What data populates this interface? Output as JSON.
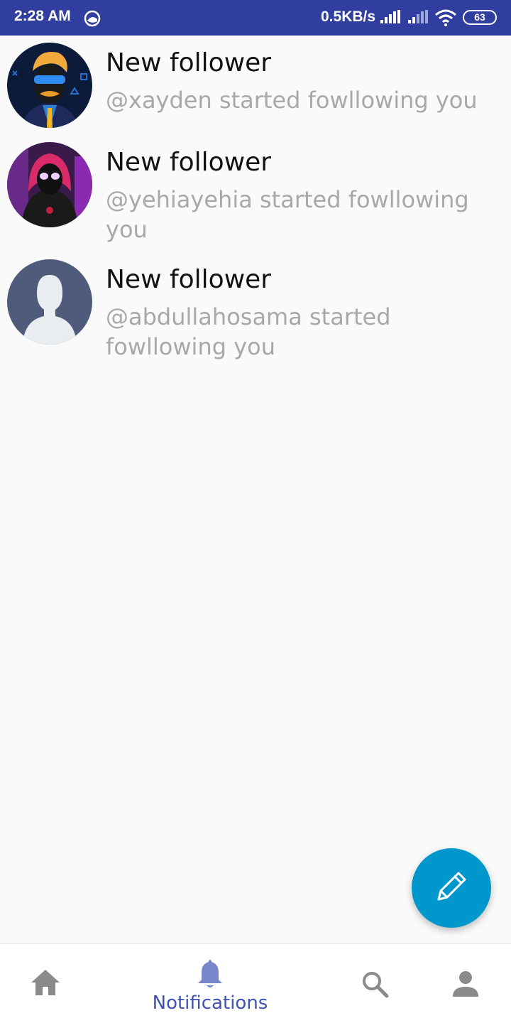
{
  "status_bar": {
    "time": "2:28 AM",
    "net_speed": "0.5KB/s",
    "battery": "63",
    "background": "#303f9f"
  },
  "notifications": [
    {
      "title": "New follower",
      "body": "@xayden started fowllowing you",
      "avatar_icon": "cartoon-man-avatar"
    },
    {
      "title": "New follower",
      "body": "@yehiayehia started fowllowing you",
      "avatar_icon": "hooded-figure-avatar"
    },
    {
      "title": "New follower",
      "body": "@abdullahosama started fowllowing you",
      "avatar_icon": "default-person-avatar"
    }
  ],
  "fab": {
    "icon": "pencil-icon",
    "color": "#0097cc"
  },
  "bottom_nav": {
    "active_label": "Notifications",
    "active_color": "#3f51b5",
    "items": [
      "home-icon",
      "bell-icon",
      "search-icon",
      "person-icon"
    ]
  }
}
